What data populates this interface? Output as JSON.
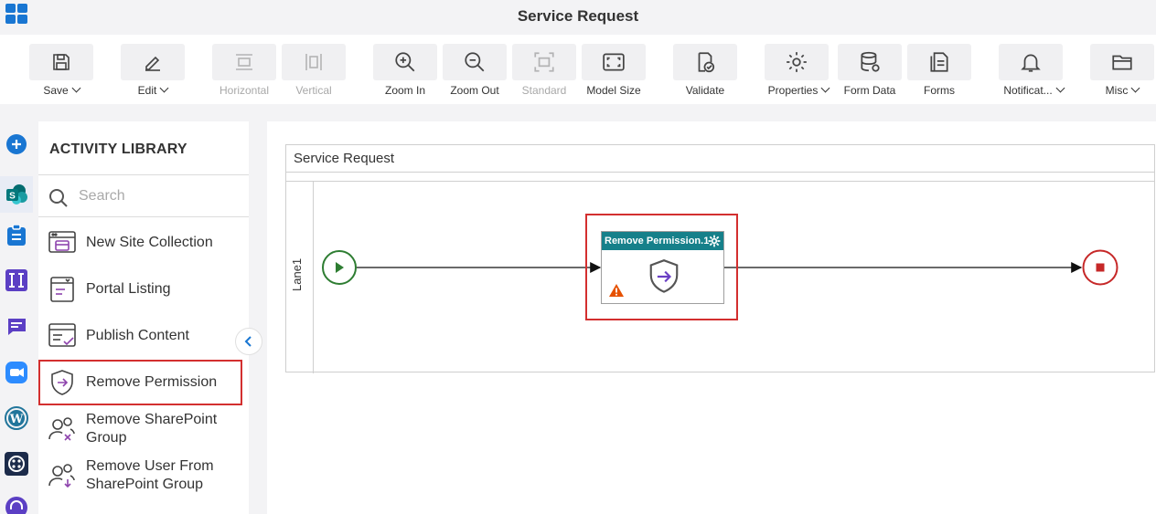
{
  "window": {
    "title": "Service Request"
  },
  "toolbar": {
    "save": "Save",
    "edit": "Edit",
    "horizontal": "Horizontal",
    "vertical": "Vertical",
    "zoom_in": "Zoom In",
    "zoom_out": "Zoom Out",
    "standard": "Standard",
    "model_size": "Model Size",
    "validate": "Validate",
    "properties": "Properties",
    "form_data": "Form Data",
    "forms": "Forms",
    "notifications": "Notificat...",
    "misc": "Misc"
  },
  "rail": {
    "icons": [
      "add-icon",
      "sharepoint-icon",
      "clipboard-icon",
      "text-icon",
      "chat-icon",
      "zoom-icon",
      "wordpress-icon",
      "dial-icon",
      "support-icon"
    ]
  },
  "library": {
    "title": "ACTIVITY LIBRARY",
    "search_placeholder": "Search",
    "items": [
      {
        "label": "New Site Collection"
      },
      {
        "label": "Portal Listing"
      },
      {
        "label": "Publish Content"
      },
      {
        "label": "Remove Permission"
      },
      {
        "label": "Remove SharePoint\nGroup"
      },
      {
        "label": "Remove User From\nSharePoint Group"
      }
    ]
  },
  "canvas": {
    "pool_title": "Service Request",
    "lane_label": "Lane1",
    "activity_title": "Remove Permission.1"
  },
  "colors": {
    "accent": "#1976d2",
    "activity_header": "#16808a",
    "selection": "#d32f2f",
    "start": "#2e7d32",
    "end": "#c62828",
    "warning": "#e65100"
  }
}
